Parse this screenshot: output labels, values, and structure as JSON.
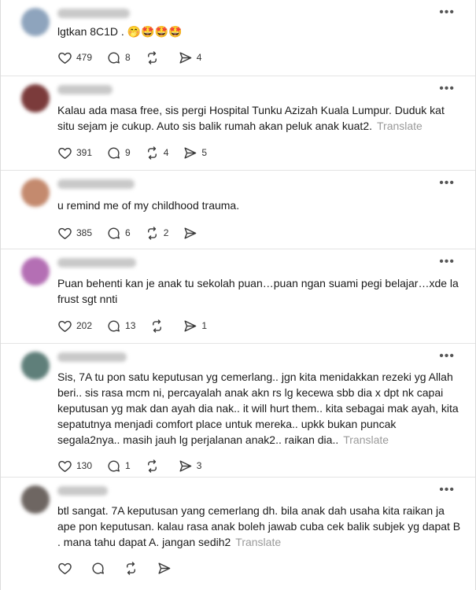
{
  "colors": {
    "text": "#1a1a1a",
    "muted": "#9a9a9a",
    "icon": "#3a3a3a",
    "divider": "#e4e4e4",
    "blur_name": "#c9c9c9"
  },
  "ui": {
    "more_symbol": "•••",
    "translate_label": "Translate"
  },
  "posts": [
    {
      "avatar_color": "#8ea4bd",
      "text": "lgtkan 8C1D . 🤭🤩🤩🤩",
      "show_translate": false,
      "likes": "479",
      "replies": "8",
      "reposts": "",
      "shares": "4"
    },
    {
      "avatar_color": "#7b3b3b",
      "text": "Kalau ada masa free, sis pergi Hospital Tunku Azizah Kuala Lumpur. Duduk kat situ sejam je cukup. Auto sis balik rumah akan peluk anak kuat2.",
      "show_translate": true,
      "likes": "391",
      "replies": "9",
      "reposts": "4",
      "shares": "5"
    },
    {
      "avatar_color": "#c48a6e",
      "text": "u remind me of my childhood trauma.",
      "show_translate": false,
      "likes": "385",
      "replies": "6",
      "reposts": "2",
      "shares": ""
    },
    {
      "avatar_color": "#b46fb4",
      "text": "Puan behenti kan je anak tu sekolah puan…puan ngan suami pegi belajar…xde la frust sgt nnti",
      "show_translate": false,
      "likes": "202",
      "replies": "13",
      "reposts": "",
      "shares": "1"
    },
    {
      "avatar_color": "#5f7f7a",
      "text": "Sis, 7A tu pon satu keputusan yg cemerlang.. jgn kita menidakkan rezeki yg Allah beri.. sis rasa mcm ni, percayalah anak akn rs lg kecewa sbb dia x dpt nk capai keputusan yg mak dan ayah dia nak.. it will hurt them.. kita sebagai mak ayah, kita sepatutnya menjadi comfort place untuk mereka.. upkk bukan puncak segala2nya.. masih jauh lg perjalanan anak2.. raikan dia..",
      "show_translate": true,
      "likes": "130",
      "replies": "1",
      "reposts": "",
      "shares": "3"
    },
    {
      "avatar_color": "#6e6662",
      "text": "btl sangat. 7A keputusan yang cemerlang dh. bila anak dah usaha kita raikan ja ape pon keputusan. kalau rasa anak boleh jawab cuba cek balik subjek yg dapat B . mana tahu dapat A. jangan sedih2",
      "show_translate": true,
      "likes": "",
      "replies": "",
      "reposts": "",
      "shares": ""
    }
  ]
}
